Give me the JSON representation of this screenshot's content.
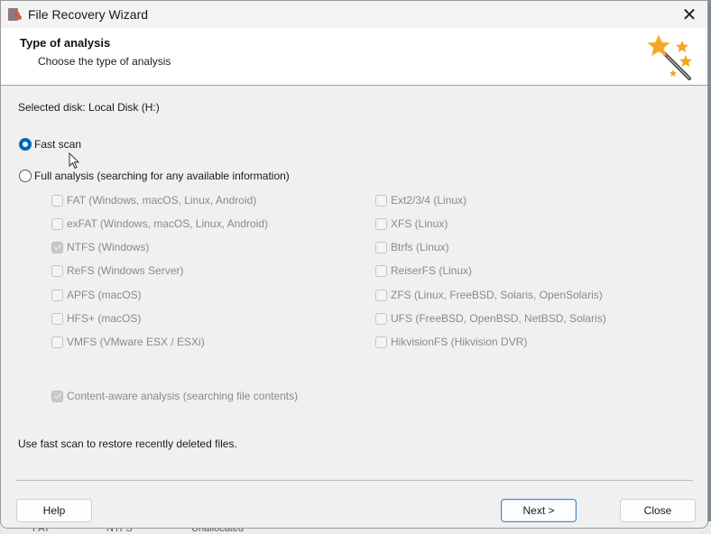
{
  "window": {
    "title": "File Recovery Wizard",
    "close_icon": "close-icon",
    "app_icon": "recovery-app-icon"
  },
  "header": {
    "title": "Type of analysis",
    "subtitle": "Choose the type of analysis",
    "icon": "magic-wand-icon"
  },
  "main": {
    "selected_disk": "Selected disk: Local Disk (H:)",
    "scan_options": [
      {
        "label": "Fast scan",
        "checked": true
      },
      {
        "label": "Full analysis (searching for any available information)",
        "checked": false
      }
    ],
    "filesystems_left": [
      {
        "label": "FAT (Windows, macOS, Linux, Android)",
        "checked": false
      },
      {
        "label": "exFAT (Windows, macOS, Linux, Android)",
        "checked": false
      },
      {
        "label": "NTFS (Windows)",
        "checked": true
      },
      {
        "label": "ReFS (Windows Server)",
        "checked": false
      },
      {
        "label": "APFS (macOS)",
        "checked": false
      },
      {
        "label": "HFS+ (macOS)",
        "checked": false
      },
      {
        "label": "VMFS (VMware ESX / ESXi)",
        "checked": false
      }
    ],
    "filesystems_right": [
      {
        "label": "Ext2/3/4 (Linux)",
        "checked": false
      },
      {
        "label": "XFS (Linux)",
        "checked": false
      },
      {
        "label": "Btrfs (Linux)",
        "checked": false
      },
      {
        "label": "ReiserFS (Linux)",
        "checked": false
      },
      {
        "label": "ZFS (Linux, FreeBSD, Solaris, OpenSolaris)",
        "checked": false
      },
      {
        "label": "UFS (FreeBSD, OpenBSD, NetBSD, Solaris)",
        "checked": false
      },
      {
        "label": "HikvisionFS (Hikvision DVR)",
        "checked": false
      }
    ],
    "content_aware": {
      "label": "Content-aware analysis (searching file contents)",
      "checked": true
    },
    "hint": "Use fast scan to restore recently deleted files."
  },
  "footer": {
    "help_label": "Help",
    "next_label": "Next >",
    "close_label": "Close"
  },
  "background": {
    "items": [
      "FAT",
      "NTFS",
      "Unallocated"
    ]
  }
}
